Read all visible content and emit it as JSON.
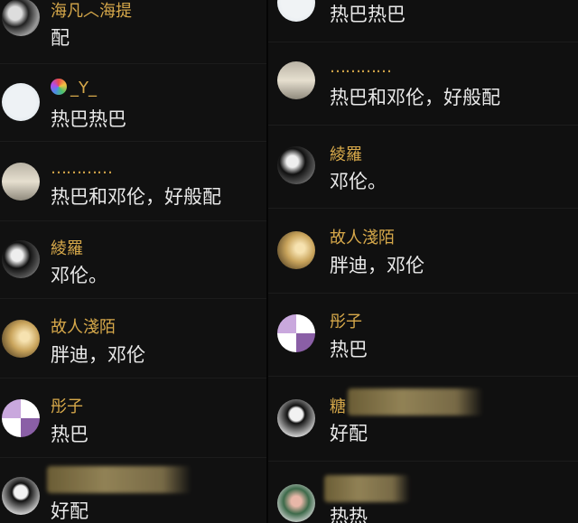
{
  "left": {
    "comments": [
      {
        "name": "海凡︿海提",
        "text": "配"
      },
      {
        "name": "_Y_",
        "text": "热巴热巴"
      },
      {
        "name": "…………",
        "text": "热巴和邓伦，好般配"
      },
      {
        "name": "綾羅",
        "text": "邓伦。"
      },
      {
        "name": "故人淺陌",
        "text": "胖迪，邓伦"
      },
      {
        "name": "彤子",
        "text": "热巴"
      },
      {
        "name": "",
        "text": "好配"
      }
    ]
  },
  "right": {
    "comments": [
      {
        "name": "",
        "text": "热巴热巴"
      },
      {
        "name": "…………",
        "text": "热巴和邓伦，好般配"
      },
      {
        "name": "綾羅",
        "text": "邓伦。"
      },
      {
        "name": "故人淺陌",
        "text": "胖迪，邓伦"
      },
      {
        "name": "彤子",
        "text": "热巴"
      },
      {
        "name": "糖",
        "text": "好配"
      },
      {
        "name": "",
        "text": "热热"
      }
    ]
  },
  "colors": {
    "name": "#d6a84a",
    "text": "#e9e9e9",
    "background": "#111111"
  }
}
